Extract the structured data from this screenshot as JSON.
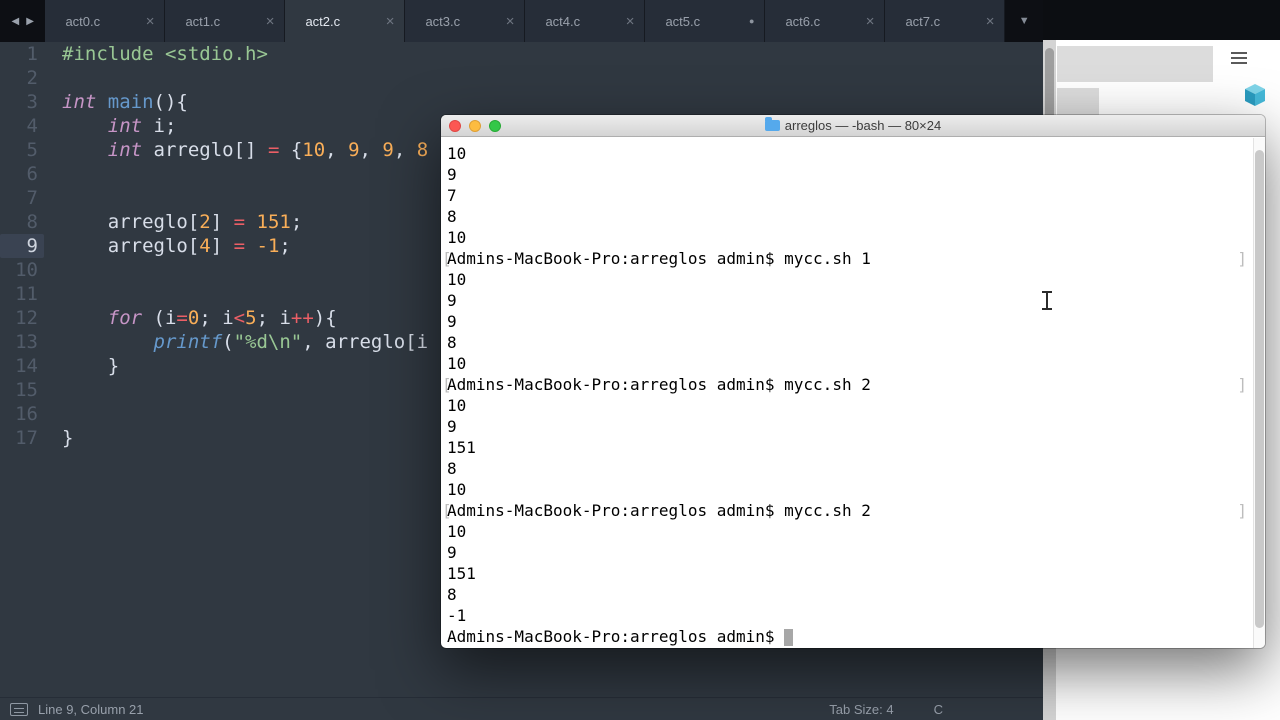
{
  "tabbar": {
    "left_arrow": "◀",
    "right_arrow": "▶",
    "overflow_icon": "▼",
    "tabs": [
      {
        "label": "act0.c",
        "close": "×"
      },
      {
        "label": "act1.c",
        "close": "×"
      },
      {
        "label": "act2.c",
        "close": "×",
        "active": true
      },
      {
        "label": "act3.c",
        "close": "×"
      },
      {
        "label": "act4.c",
        "close": "×"
      },
      {
        "label": "act5.c",
        "modified": true,
        "dot": "●"
      },
      {
        "label": "act6.c",
        "close": "×"
      },
      {
        "label": "act7.c",
        "close": "×"
      }
    ]
  },
  "editor": {
    "current_line": 9,
    "lines": [
      {
        "num": 1,
        "tokens": [
          {
            "t": "#include <stdio.h>",
            "c": "pp"
          }
        ]
      },
      {
        "num": 2,
        "tokens": []
      },
      {
        "num": 3,
        "tokens": [
          {
            "t": "int",
            "c": "kw"
          },
          {
            "t": " "
          },
          {
            "t": "main",
            "c": "fn"
          },
          {
            "t": "(){"
          }
        ]
      },
      {
        "num": 4,
        "tokens": [
          {
            "t": "    "
          },
          {
            "t": "int",
            "c": "kw"
          },
          {
            "t": " i;"
          }
        ]
      },
      {
        "num": 5,
        "tokens": [
          {
            "t": "    "
          },
          {
            "t": "int",
            "c": "kw"
          },
          {
            "t": " arreglo[] "
          },
          {
            "t": "=",
            "c": "op"
          },
          {
            "t": " {"
          },
          {
            "t": "10",
            "c": "num"
          },
          {
            "t": ", "
          },
          {
            "t": "9",
            "c": "num"
          },
          {
            "t": ", "
          },
          {
            "t": "9",
            "c": "num"
          },
          {
            "t": ", "
          },
          {
            "t": "8",
            "c": "num"
          }
        ]
      },
      {
        "num": 6,
        "tokens": []
      },
      {
        "num": 7,
        "tokens": []
      },
      {
        "num": 8,
        "tokens": [
          {
            "t": "    arreglo["
          },
          {
            "t": "2",
            "c": "num"
          },
          {
            "t": "] "
          },
          {
            "t": "=",
            "c": "op"
          },
          {
            "t": " "
          },
          {
            "t": "151",
            "c": "num"
          },
          {
            "t": ";"
          }
        ]
      },
      {
        "num": 9,
        "current": true,
        "tokens": [
          {
            "t": "    arreglo["
          },
          {
            "t": "4",
            "c": "num"
          },
          {
            "t": "] "
          },
          {
            "t": "=",
            "c": "op"
          },
          {
            "t": " "
          },
          {
            "t": "-1",
            "c": "num"
          },
          {
            "t": ";"
          }
        ]
      },
      {
        "num": 10,
        "tokens": []
      },
      {
        "num": 11,
        "tokens": []
      },
      {
        "num": 12,
        "tokens": [
          {
            "t": "    "
          },
          {
            "t": "for",
            "c": "kw"
          },
          {
            "t": " (i"
          },
          {
            "t": "=",
            "c": "op"
          },
          {
            "t": "0",
            "c": "num"
          },
          {
            "t": "; i"
          },
          {
            "t": "<",
            "c": "op"
          },
          {
            "t": "5",
            "c": "num"
          },
          {
            "t": "; i"
          },
          {
            "t": "++",
            "c": "op"
          },
          {
            "t": "){"
          }
        ]
      },
      {
        "num": 13,
        "tokens": [
          {
            "t": "        "
          },
          {
            "t": "printf",
            "c": "fnit"
          },
          {
            "t": "("
          },
          {
            "t": "\"%d\\n\"",
            "c": "str"
          },
          {
            "t": ", arreglo[i"
          }
        ]
      },
      {
        "num": 14,
        "tokens": [
          {
            "t": "    }"
          }
        ]
      },
      {
        "num": 15,
        "tokens": []
      },
      {
        "num": 16,
        "tokens": []
      },
      {
        "num": 17,
        "tokens": [
          {
            "t": "}"
          }
        ]
      }
    ]
  },
  "statusbar": {
    "position": "Line 9, Column 21",
    "tab_size": "Tab Size: 4",
    "syntax": "C"
  },
  "terminal": {
    "title": "arreglos — -bash — 80×24",
    "lines": [
      {
        "text": "10"
      },
      {
        "text": "9"
      },
      {
        "text": "7"
      },
      {
        "text": "8"
      },
      {
        "text": "10"
      },
      {
        "text": "Admins-MacBook-Pro:arreglos admin$ mycc.sh 1",
        "mark": true
      },
      {
        "text": "10"
      },
      {
        "text": "9"
      },
      {
        "text": "9"
      },
      {
        "text": "8"
      },
      {
        "text": "10"
      },
      {
        "text": "Admins-MacBook-Pro:arreglos admin$ mycc.sh 2",
        "mark": true
      },
      {
        "text": "10"
      },
      {
        "text": "9"
      },
      {
        "text": "151"
      },
      {
        "text": "8"
      },
      {
        "text": "10"
      },
      {
        "text": "Admins-MacBook-Pro:arreglos admin$ mycc.sh 2",
        "mark": true
      },
      {
        "text": "10"
      },
      {
        "text": "9"
      },
      {
        "text": "151"
      },
      {
        "text": "8"
      },
      {
        "text": "-1"
      },
      {
        "text": "Admins-MacBook-Pro:arreglos admin$ ",
        "cursor": true
      }
    ],
    "mark_left": "[",
    "mark_right": "]"
  },
  "colors": {
    "editor_bg": "#303841",
    "keyword": "#c695c6",
    "function": "#6699cc",
    "number": "#f9ae58",
    "operator": "#ec5f66",
    "string": "#99c794",
    "tab_active_text": "#e3e8f0",
    "terminal_bg": "#ffffff"
  }
}
